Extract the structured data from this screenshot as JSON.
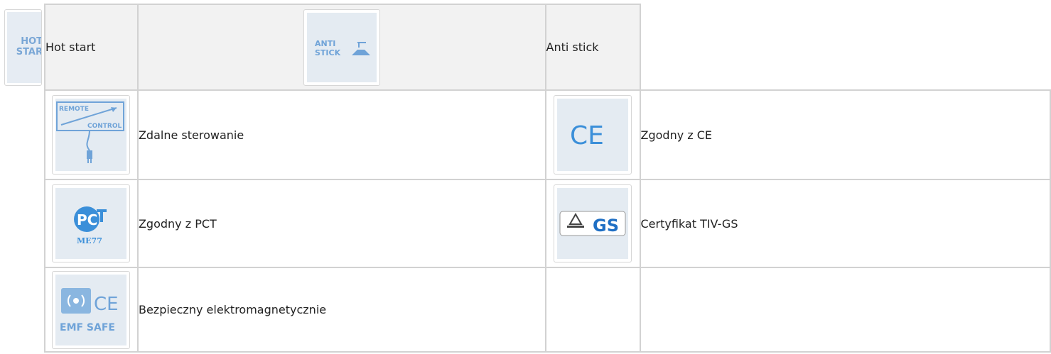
{
  "floating_icon": {
    "line1": "HOT",
    "line2": "STAR"
  },
  "rows": [
    {
      "left_label": "Hot start",
      "right_label": "Anti stick",
      "right_icon_text": [
        "ANTI",
        "STICK"
      ]
    },
    {
      "left_label": "Zdalne sterowanie",
      "left_icon_text": [
        "REMOTE",
        "CONTROL"
      ],
      "right_label": "Zgodny z CE",
      "right_icon_text": "CE"
    },
    {
      "left_label": "Zgodny z PCT",
      "left_icon_text": [
        "PC",
        "ME77"
      ],
      "right_label": "Certyfikat TIV-GS",
      "right_icon_text": "GS"
    },
    {
      "left_label": "Bezpieczny elektromagnetycznie",
      "left_icon_text": [
        "CE",
        "EMF SAFE"
      ],
      "right_label": ""
    }
  ],
  "colors": {
    "icon_blue": "#6fa3d8",
    "icon_bg": "#e4ebf2",
    "grid": "#d2d2d2",
    "header_bg": "#f2f2f2"
  }
}
